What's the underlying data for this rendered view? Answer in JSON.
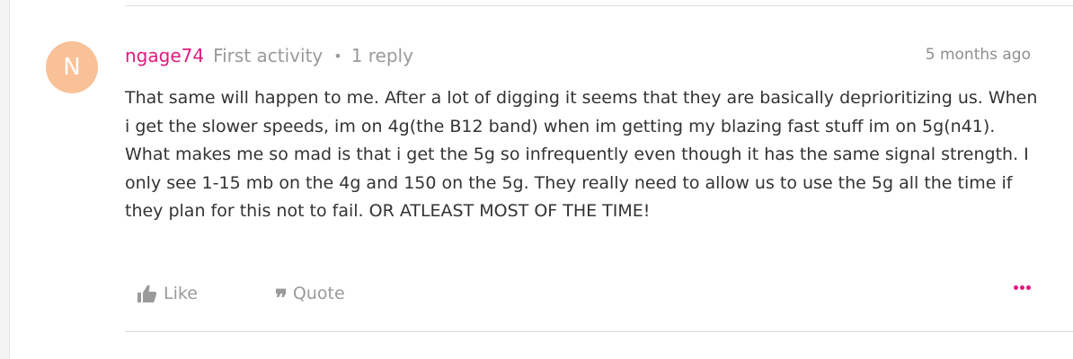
{
  "post": {
    "avatar_initial": "N",
    "author": "ngage74",
    "badge": "First activity",
    "separator": "•",
    "replies": "1 reply",
    "timestamp": "5 months ago",
    "body": "That same will happen to me. After a lot of digging it seems that they are basically deprioritizing us. When i get the slower speeds, im on 4g(the B12 band) when im getting my blazing fast stuff im on 5g(n41). What makes me so mad is that i get the 5g so infrequently even though it has the same signal strength. I only see 1-15 mb on the 4g and 150 on the 5g. They really need to allow us to use the 5g all the time if they plan for this not to fail. OR ATLEAST MOST OF THE TIME!",
    "actions": {
      "like_label": "Like",
      "quote_label": "Quote",
      "quote_icon_glyph": "❞"
    }
  },
  "icons": {
    "like": "thumbs-up-icon",
    "quote": "quote-icon",
    "more": "more-options-icon"
  },
  "colors": {
    "accent": "#e0197d",
    "avatar_bg": "#f9c198",
    "muted_text": "#9a9a9a",
    "body_text": "#333333"
  }
}
